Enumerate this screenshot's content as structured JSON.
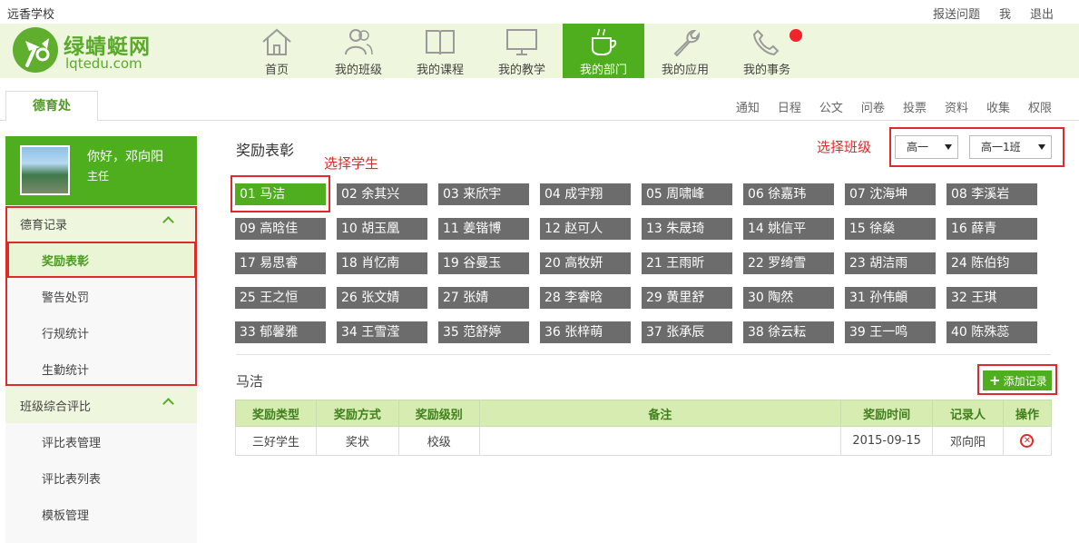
{
  "topbar": {
    "school_name": "远香学校",
    "links": [
      "报送问题",
      "我",
      "退出"
    ]
  },
  "logo": {
    "cn": "绿蜻蜓网",
    "en": "lqtedu.com"
  },
  "nav": {
    "items": [
      {
        "label": "首页",
        "icon": "house-icon"
      },
      {
        "label": "我的班级",
        "icon": "people-icon"
      },
      {
        "label": "我的课程",
        "icon": "book-icon"
      },
      {
        "label": "我的教学",
        "icon": "monitor-icon"
      },
      {
        "label": "我的部门",
        "icon": "coffee-cup-icon",
        "active": true
      },
      {
        "label": "我的应用",
        "icon": "wrench-icon"
      },
      {
        "label": "我的事务",
        "icon": "phone-icon",
        "notification": true
      }
    ]
  },
  "tabs": {
    "department": "德育处",
    "right": [
      "通知",
      "日程",
      "公文",
      "问卷",
      "投票",
      "资料",
      "收集",
      "权限"
    ]
  },
  "sidebar": {
    "greeting": "你好，邓向阳",
    "role": "主任",
    "section1": "德育记录",
    "section1_items": [
      "奖励表彰",
      "警告处罚",
      "行规统计",
      "生勤统计"
    ],
    "section2": "班级综合评比",
    "section2_items": [
      "评比表管理",
      "评比表列表",
      "模板管理"
    ]
  },
  "main": {
    "title": "奖励表彰",
    "annotation_select_class": "选择班级",
    "annotation_select_student": "选择学生",
    "grade_select": "高一",
    "class_select": "高一1班",
    "students": [
      "01 马洁",
      "02 余其兴",
      "03 来欣宇",
      "04 成宇翔",
      "05 周啸峰",
      "06 徐嘉玮",
      "07 沈海坤",
      "08 李溪岩",
      "09 高晗佳",
      "10 胡玉凰",
      "11 姜锴博",
      "12 赵可人",
      "13 朱晟琦",
      "14 姚信平",
      "15 徐燊",
      "16 薛青",
      "17 易思睿",
      "18 肖忆南",
      "19 谷曼玉",
      "20 高牧妍",
      "21 王雨昕",
      "22 罗绮雪",
      "23 胡洁雨",
      "24 陈伯钧",
      "25 王之恒",
      "26 张文婧",
      "27 张婧",
      "28 李睿晗",
      "29 黄里舒",
      "30 陶然",
      "31 孙伟頔",
      "32 王琪",
      "33 郁馨雅",
      "34 王雪滢",
      "35 范舒婷",
      "36 张梓萌",
      "37 张承辰",
      "38 徐云耘",
      "39 王一鸣",
      "40 陈殊蕊"
    ],
    "selected_student": "马洁",
    "add_button": "添加记录",
    "table": {
      "headers": [
        "奖励类型",
        "奖励方式",
        "奖励级别",
        "备注",
        "奖励时间",
        "记录人",
        "操作"
      ],
      "rows": [
        [
          "三好学生",
          "奖状",
          "校级",
          "",
          "2015-09-15",
          "邓向阳"
        ]
      ]
    }
  },
  "colors": {
    "brand_green": "#4fae1e",
    "header_bg": "#eef6dd",
    "student_gray": "#6c6c6c",
    "annotation_red": "#e02a2a"
  }
}
